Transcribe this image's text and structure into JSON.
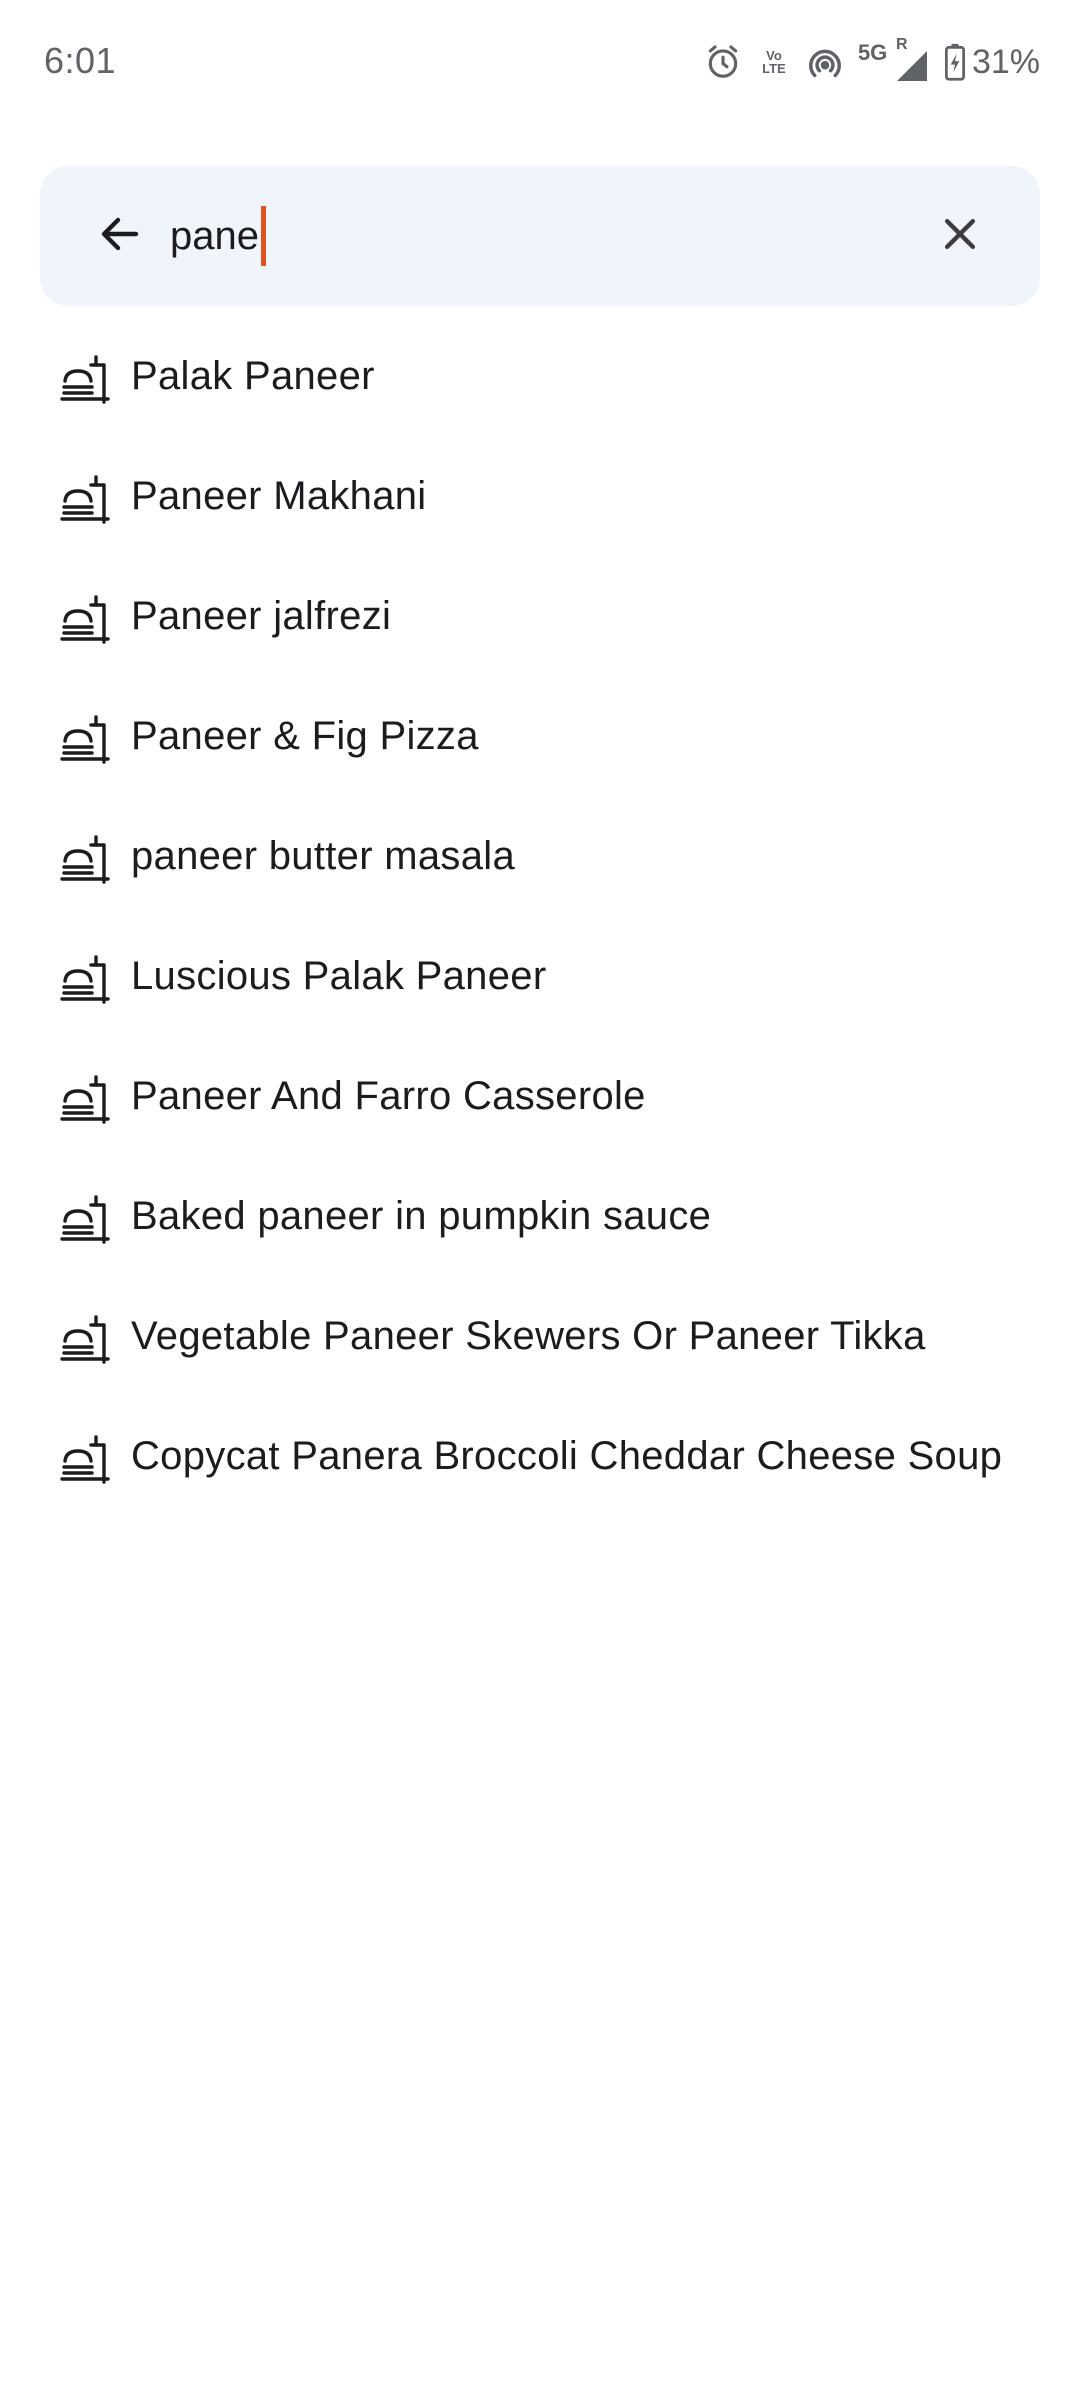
{
  "status_bar": {
    "time": "6:01",
    "icons": [
      "alarm-icon",
      "volte-icon",
      "hotspot-icon",
      "5g-signal-icon",
      "battery-charging-icon"
    ],
    "network_label": "5G",
    "roaming_label": "R",
    "volte_top": "Vo",
    "volte_bottom": "LTE",
    "battery_percent": "31%"
  },
  "search": {
    "query": "pane",
    "back_icon": "arrow-back-icon",
    "clear_icon": "close-icon",
    "caret_color": "#e0531f",
    "background_color": "#f0f4fb"
  },
  "suggestions": [
    {
      "label": "Palak Paneer",
      "icon": "food-dish-icon"
    },
    {
      "label": "Paneer Makhani",
      "icon": "food-dish-icon"
    },
    {
      "label": "Paneer jalfrezi",
      "icon": "food-dish-icon"
    },
    {
      "label": "Paneer & Fig Pizza",
      "icon": "food-dish-icon"
    },
    {
      "label": "paneer butter masala",
      "icon": "food-dish-icon"
    },
    {
      "label": "Luscious Palak Paneer",
      "icon": "food-dish-icon"
    },
    {
      "label": "Paneer And Farro Casserole",
      "icon": "food-dish-icon"
    },
    {
      "label": "Baked paneer in pumpkin sauce",
      "icon": "food-dish-icon"
    },
    {
      "label": "Vegetable Paneer Skewers Or Paneer Tikka",
      "icon": "food-dish-icon"
    },
    {
      "label": "Copycat Panera Broccoli Cheddar Cheese Soup",
      "icon": "food-dish-icon"
    }
  ]
}
